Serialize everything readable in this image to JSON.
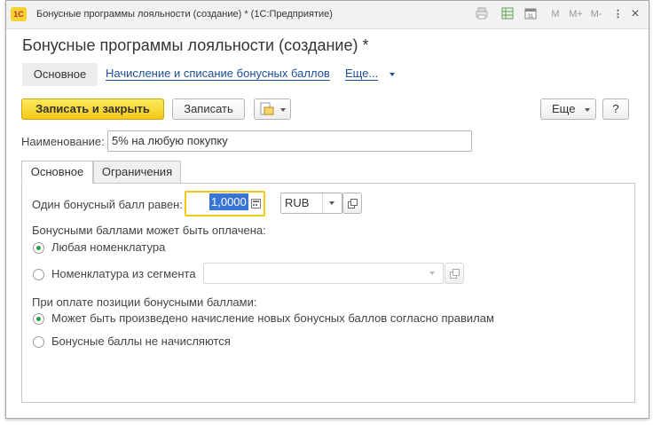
{
  "window": {
    "title": "Бонусные программы лояльности (создание) * (1С:Предприятие)",
    "logo_text": "1С",
    "buttons": [
      "M",
      "M+",
      "M-",
      "⋮",
      "×"
    ]
  },
  "form": {
    "title": "Бонусные программы лояльности (создание) *"
  },
  "nav": {
    "active": "Основное",
    "link": "Начисление и списание бонусных баллов",
    "more": "Еще..."
  },
  "toolbar": {
    "save_close": "Записать и закрыть",
    "save": "Записать",
    "more": "Еще",
    "help": "?"
  },
  "name_field": {
    "label": "Наименование:",
    "value": "5% на любую покупку"
  },
  "tabs": [
    "Основное",
    "Ограничения"
  ],
  "main": {
    "points_label": "Один бонусный балл равен:",
    "points_value": "1,0000",
    "currency": "RUB",
    "paid_title": "Бонусными баллами может быть оплачена:",
    "paid_options": [
      "Любая номенклатура",
      "Номенклатура из сегмента"
    ],
    "paid_selected": 0,
    "segment_value": "",
    "accrual_title": "При оплате позиции бонусными баллами:",
    "accrual_options": [
      "Может быть произведено начисление новых бонусных баллов согласно правилам",
      "Бонусные баллы не начисляются"
    ],
    "accrual_selected": 0
  },
  "colors": {
    "primary_button": "#f3c918",
    "link": "#1b4f9a",
    "radio_selected": "#2a9d45",
    "focus_border": "#f3c918",
    "selection": "#3875d7"
  }
}
